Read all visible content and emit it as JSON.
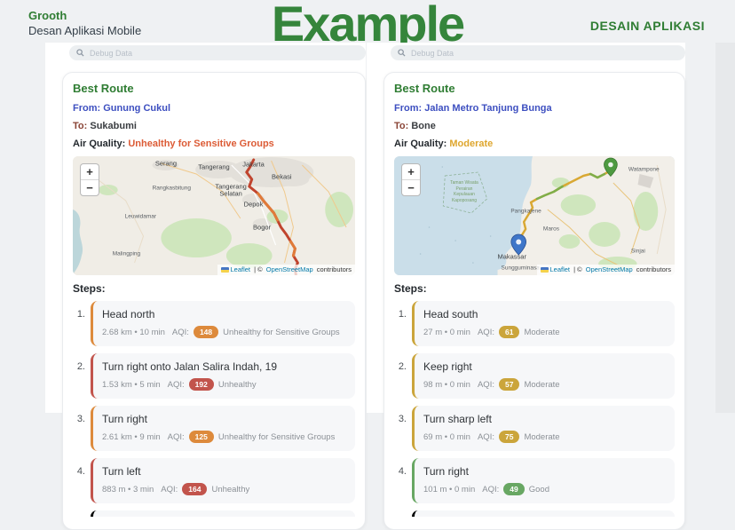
{
  "header": {
    "brand": "Grooth",
    "subtitle": "Desan Aplikasi Mobile",
    "watermark": "Example",
    "right_title": "DESAIN APLIKASI"
  },
  "search_placeholder": "Debug Data",
  "map_ui": {
    "zoom_in": "+",
    "zoom_out": "−",
    "attribution": {
      "leaflet": "Leaflet",
      "mid": " | © ",
      "osm": "OpenStreetMap",
      "suffix": " contributors"
    }
  },
  "colors": {
    "brand_green": "#2f7d33",
    "from_blue": "#3d4fc0",
    "to_maroon": "#8a4436",
    "aq_usg": "#dc5b35",
    "aq_moderate": "#dea62e",
    "badge_usg_orange": "#dd8a3c",
    "badge_unhealthy_red": "#c2544c",
    "badge_moderate_yellow": "#cba53b",
    "badge_good_green": "#68a763",
    "route_left_red": "#c0442e",
    "route_left_orange": "#e07b39",
    "route_right_yellow": "#d9a833",
    "route_right_green": "#7fae4a"
  },
  "phones": [
    {
      "card": {
        "title": "Best Route",
        "from_label": "From:",
        "from_value": "Gunung Cukul",
        "to_label": "To:",
        "to_value": "Sukabumi",
        "aq_label": "Air Quality:",
        "aq_value": "Unhealthy for Sensitive Groups"
      },
      "map": {
        "labels": [
          "Serang",
          "Tangerang",
          "Jakarta",
          "Bekasi",
          "Tangerang Selatan",
          "Depok",
          "Bogor",
          "Rangkasbitung",
          "Leuwidamar",
          "Malingping"
        ]
      },
      "steps_label": "Steps:",
      "steps": [
        {
          "num": "1.",
          "title": "Head north",
          "distance": "2.68 km • 10 min",
          "aqi_label": "AQI:",
          "aqi": "148",
          "category": "Unhealthy for Sensitive Groups"
        },
        {
          "num": "2.",
          "title": "Turn right onto Jalan Salira Indah, 19",
          "distance": "1.53 km • 5 min",
          "aqi_label": "AQI:",
          "aqi": "192",
          "category": "Unhealthy"
        },
        {
          "num": "3.",
          "title": "Turn right",
          "distance": "2.61 km • 9 min",
          "aqi_label": "AQI:",
          "aqi": "125",
          "category": "Unhealthy for Sensitive Groups"
        },
        {
          "num": "4.",
          "title": "Turn left",
          "distance": "883 m • 3 min",
          "aqi_label": "AQI:",
          "aqi": "164",
          "category": "Unhealthy"
        }
      ]
    },
    {
      "card": {
        "title": "Best Route",
        "from_label": "From:",
        "from_value": "Jalan Metro Tanjung Bunga",
        "to_label": "To:",
        "to_value": "Bone",
        "aq_label": "Air Quality:",
        "aq_value": "Moderate"
      },
      "map": {
        "labels": [
          "Watampone",
          "Pangkajene",
          "Maros",
          "Makassar",
          "Sungguminasa",
          "Sinjai"
        ],
        "marine_park": "Taman Wisata Perairan Kepulauan Kapoposang"
      },
      "steps_label": "Steps:",
      "steps": [
        {
          "num": "1.",
          "title": "Head south",
          "distance": "27 m • 0 min",
          "aqi_label": "AQI:",
          "aqi": "61",
          "category": "Moderate"
        },
        {
          "num": "2.",
          "title": "Keep right",
          "distance": "98 m • 0 min",
          "aqi_label": "AQI:",
          "aqi": "57",
          "category": "Moderate"
        },
        {
          "num": "3.",
          "title": "Turn sharp left",
          "distance": "69 m • 0 min",
          "aqi_label": "AQI:",
          "aqi": "75",
          "category": "Moderate"
        },
        {
          "num": "4.",
          "title": "Turn right",
          "distance": "101 m • 0 min",
          "aqi_label": "AQI:",
          "aqi": "49",
          "category": "Good"
        }
      ]
    }
  ]
}
